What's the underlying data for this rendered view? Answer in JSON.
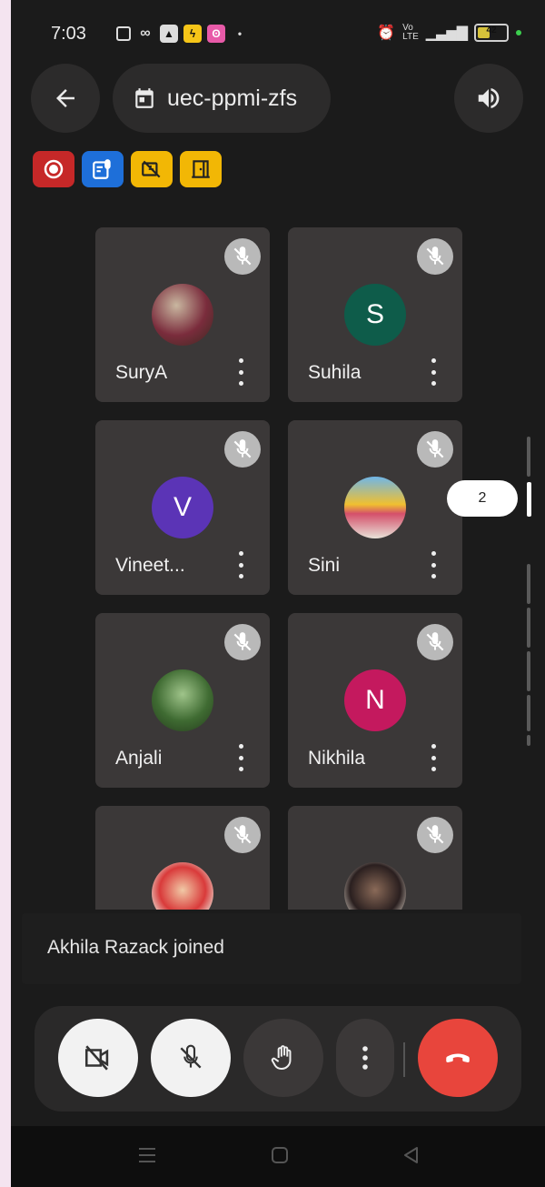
{
  "status_bar": {
    "time": "7:03",
    "battery": "42",
    "battery_level_percent": 42,
    "network": "4G"
  },
  "top_bar": {
    "back_icon": "arrow-left-icon",
    "meeting_code": "uec-ppmi-zfs",
    "meeting_icon": "calendar-icon",
    "speaker_icon": "speaker-icon"
  },
  "indicator_badges": [
    {
      "name": "recording-badge",
      "icon": "record-icon",
      "color": "#c62828"
    },
    {
      "name": "transcription-badge",
      "icon": "transcript-icon",
      "color": "#1e6fd9"
    },
    {
      "name": "camera-off-badge",
      "icon": "video-off-icon",
      "color": "#f2b705"
    },
    {
      "name": "breakout-badge",
      "icon": "door-icon",
      "color": "#f2b705"
    }
  ],
  "participants": [
    {
      "name": "SuryA",
      "avatar_type": "photo",
      "muted": true
    },
    {
      "name": "Suhila",
      "avatar_type": "initial",
      "initial": "S",
      "avatar_color": "#0e5c4a",
      "muted": true
    },
    {
      "name": "Vineet...",
      "avatar_type": "initial",
      "initial": "V",
      "avatar_color": "#5b34b6",
      "muted": true
    },
    {
      "name": "Sini",
      "avatar_type": "photo",
      "muted": true
    },
    {
      "name": "Anjali",
      "avatar_type": "photo",
      "muted": true
    },
    {
      "name": "Nikhila",
      "avatar_type": "initial",
      "initial": "N",
      "avatar_color": "#c4195e",
      "muted": true
    },
    {
      "name": "",
      "avatar_type": "photo",
      "muted": true
    },
    {
      "name": "",
      "avatar_type": "photo",
      "muted": true
    }
  ],
  "pager": {
    "current_page": "2",
    "current_page_index": 2
  },
  "toast": {
    "message": "Akhila Razack joined"
  },
  "controls": {
    "camera": "video-off-icon",
    "mic": "mic-off-icon",
    "hand": "raise-hand-icon",
    "more": "more-vert-icon",
    "leave": "hang-up-icon",
    "leave_color": "#e8453c"
  },
  "nav": [
    "recents-icon",
    "home-icon",
    "back-triangle-icon"
  ]
}
